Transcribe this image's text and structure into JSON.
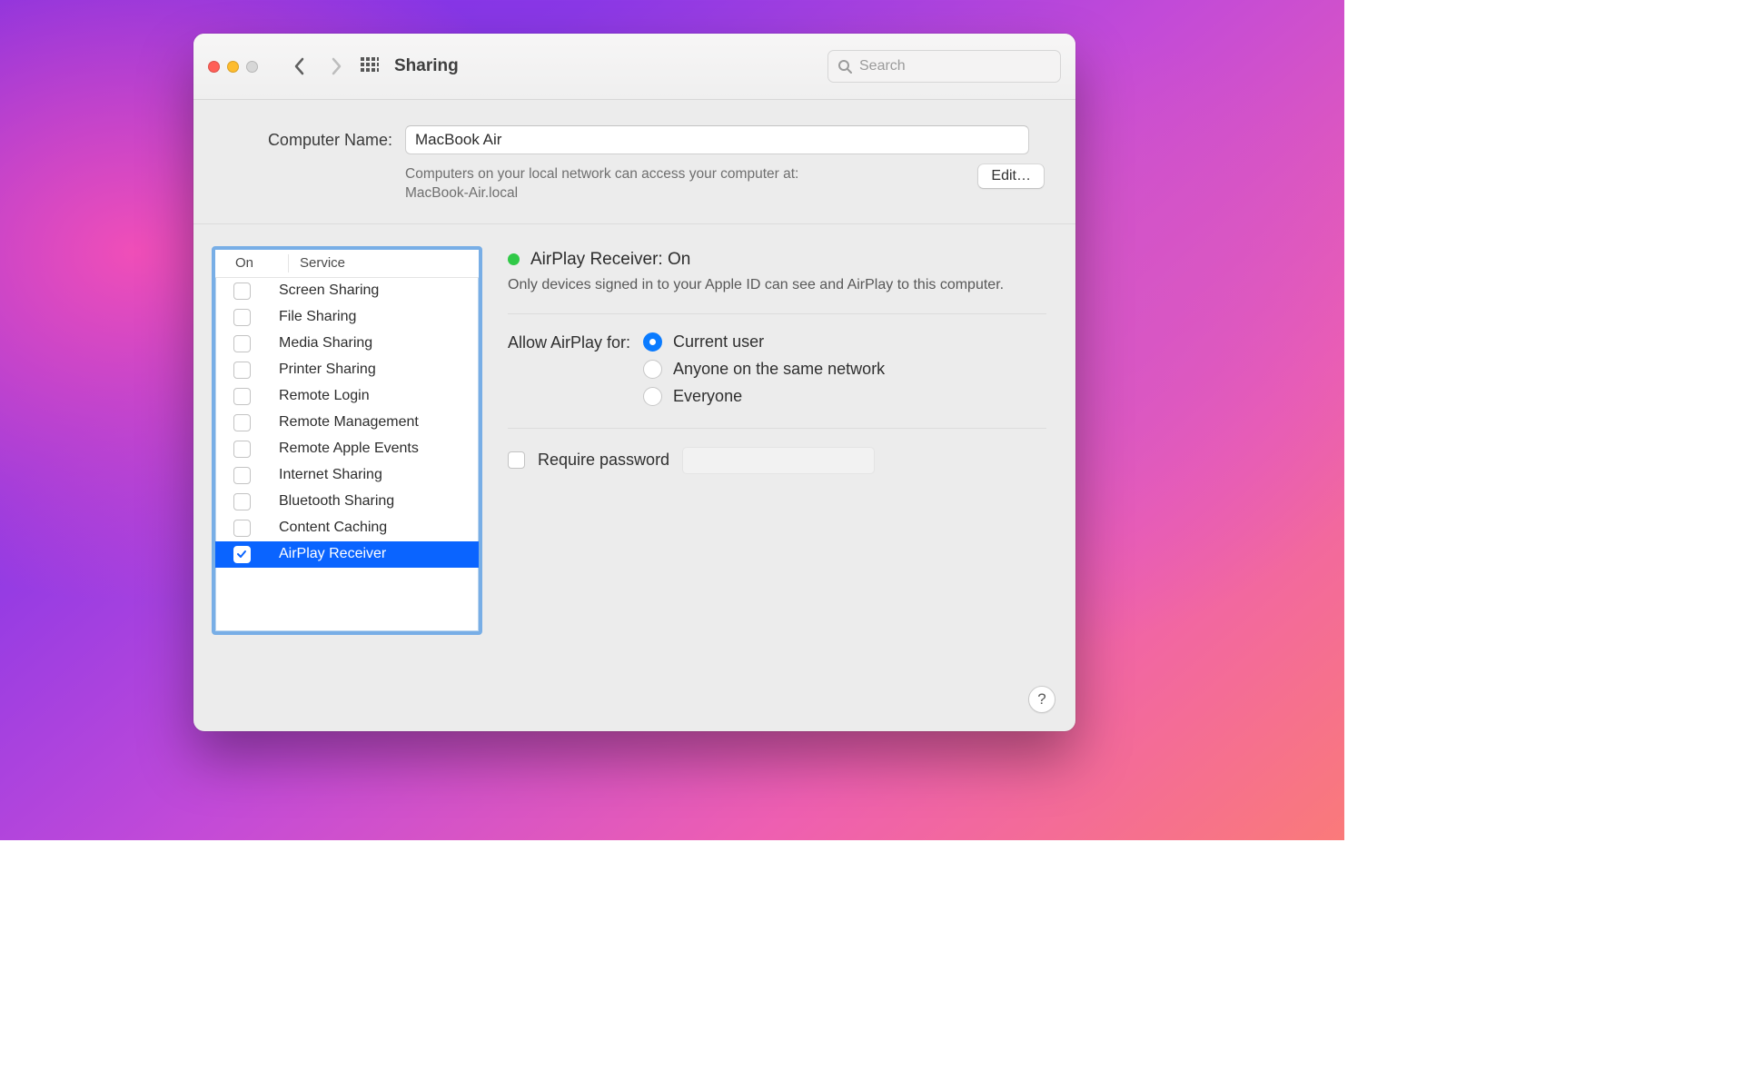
{
  "titlebar": {
    "title": "Sharing",
    "search_placeholder": "Search"
  },
  "header": {
    "computer_name_label": "Computer Name:",
    "computer_name_value": "MacBook Air",
    "access_text_line1": "Computers on your local network can access your computer at:",
    "access_text_line2": "MacBook-Air.local",
    "edit_label": "Edit…"
  },
  "table": {
    "col_on": "On",
    "col_service": "Service",
    "services": [
      {
        "name": "Screen Sharing",
        "on": false,
        "selected": false
      },
      {
        "name": "File Sharing",
        "on": false,
        "selected": false
      },
      {
        "name": "Media Sharing",
        "on": false,
        "selected": false
      },
      {
        "name": "Printer Sharing",
        "on": false,
        "selected": false
      },
      {
        "name": "Remote Login",
        "on": false,
        "selected": false
      },
      {
        "name": "Remote Management",
        "on": false,
        "selected": false
      },
      {
        "name": "Remote Apple Events",
        "on": false,
        "selected": false
      },
      {
        "name": "Internet Sharing",
        "on": false,
        "selected": false
      },
      {
        "name": "Bluetooth Sharing",
        "on": false,
        "selected": false
      },
      {
        "name": "Content Caching",
        "on": false,
        "selected": false
      },
      {
        "name": "AirPlay Receiver",
        "on": true,
        "selected": true
      }
    ]
  },
  "detail": {
    "status_title": "AirPlay Receiver: On",
    "status_desc": "Only devices signed in to your Apple ID can see and AirPlay to this computer.",
    "allow_label": "Allow AirPlay for:",
    "options": [
      {
        "label": "Current user",
        "checked": true
      },
      {
        "label": "Anyone on the same network",
        "checked": false
      },
      {
        "label": "Everyone",
        "checked": false
      }
    ],
    "require_pw_label": "Require password",
    "require_pw_checked": false
  },
  "help_label": "?"
}
